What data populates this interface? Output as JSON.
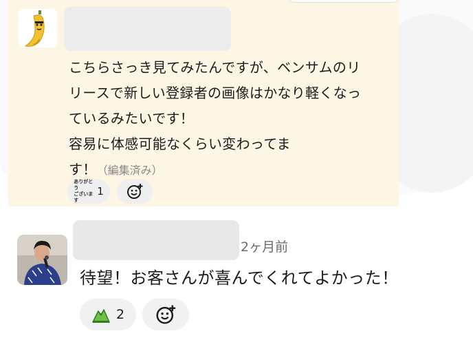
{
  "message1": {
    "lines": [
      "こちらさっき見てみたんですが、ベンサムのリ",
      "リースで新しい登録者の画像はかなり軽くなっ",
      "ているみたいです！",
      "容易に体感可能なくらい変わってま",
      "す！"
    ],
    "edited_label": "（編集済み）",
    "reactions": [
      {
        "emoji_text_line1": "ありがとう",
        "emoji_text_line2": "ございます",
        "count": "1"
      }
    ]
  },
  "message2": {
    "timestamp": "2ヶ月前",
    "text": "待望！お客さんが喜んでくれてよかった！",
    "reactions": [
      {
        "emoji": "mountain-emoji",
        "count": "2"
      }
    ]
  },
  "colors": {
    "highlight_bg": "#fdf6e5",
    "reaction_bg": "#efefef",
    "text": "#1d1c1d",
    "muted": "#8a8a8a"
  }
}
